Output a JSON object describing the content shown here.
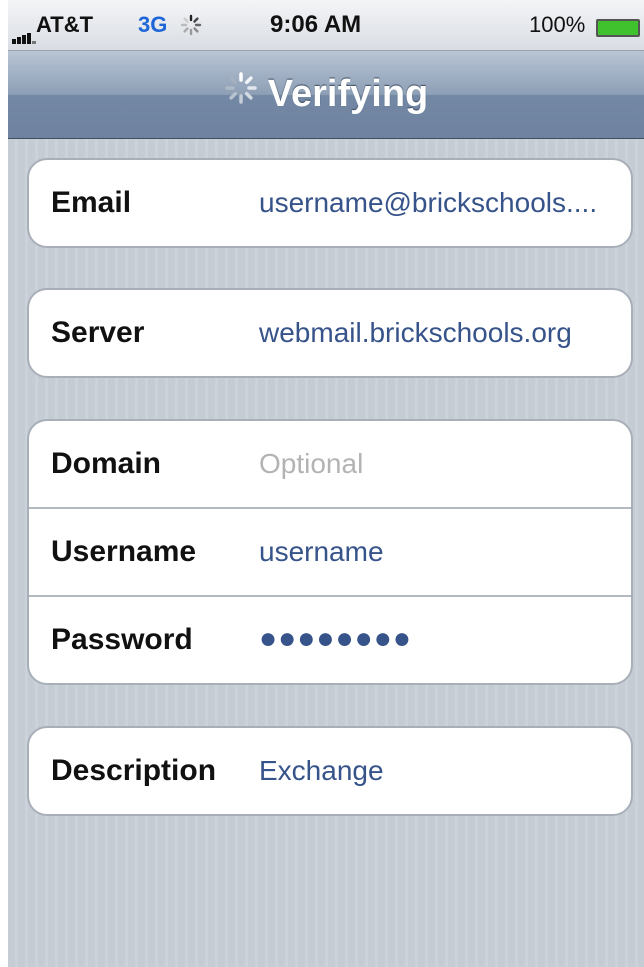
{
  "status_bar": {
    "carrier": "AT&T",
    "network": "3G",
    "time": "9:06 AM",
    "battery_percent": "100%"
  },
  "nav_bar": {
    "title": "Verifying"
  },
  "fields": {
    "email": {
      "label": "Email",
      "value": "username@brickschools...."
    },
    "server": {
      "label": "Server",
      "value": "webmail.brickschools.org"
    },
    "domain": {
      "label": "Domain",
      "placeholder": "Optional"
    },
    "username": {
      "label": "Username",
      "value": "username"
    },
    "password": {
      "label": "Password",
      "value": "●●●●●●●●"
    },
    "description": {
      "label": "Description",
      "value": "Exchange"
    }
  },
  "colors": {
    "value_text": "#36538a",
    "nav_bar": "#8d9fb6",
    "network": "#1f66d8",
    "battery": "#3fc22e"
  }
}
